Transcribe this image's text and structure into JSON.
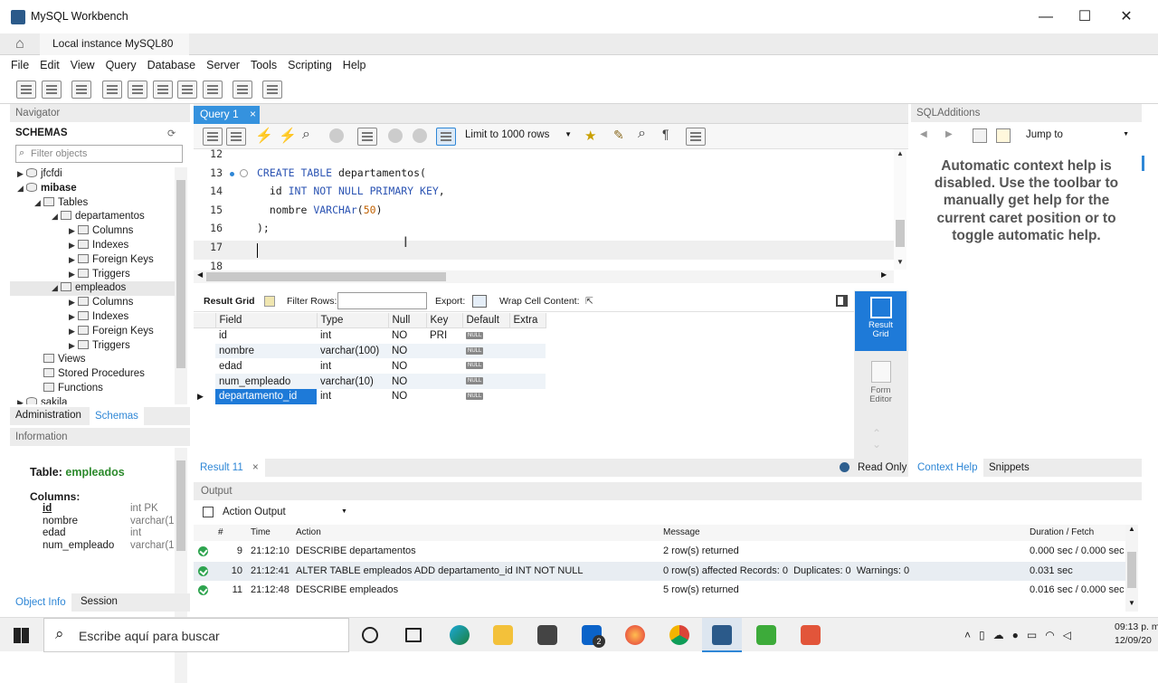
{
  "window": {
    "title": "MySQL Workbench",
    "minimize": "—",
    "maximize": "☐",
    "close": "✕"
  },
  "conn_tab": {
    "label": "Local instance MySQL80",
    "close": "×"
  },
  "menu": [
    "File",
    "Edit",
    "View",
    "Query",
    "Database",
    "Server",
    "Tools",
    "Scripting",
    "Help"
  ],
  "navigator": {
    "header": "Navigator",
    "schemas_label": "SCHEMAS",
    "filter_placeholder": "Filter objects",
    "tree": [
      {
        "label": "jfcfdi",
        "level": 0,
        "arrow": "▶",
        "bold": false
      },
      {
        "label": "mibase",
        "level": 0,
        "arrow": "◢",
        "bold": true
      },
      {
        "label": "Tables",
        "level": 1,
        "arrow": "◢",
        "bold": false
      },
      {
        "label": "departamentos",
        "level": 2,
        "arrow": "◢",
        "bold": false
      },
      {
        "label": "Columns",
        "level": 3,
        "arrow": "▶",
        "bold": false
      },
      {
        "label": "Indexes",
        "level": 3,
        "arrow": "▶",
        "bold": false
      },
      {
        "label": "Foreign Keys",
        "level": 3,
        "arrow": "▶",
        "bold": false
      },
      {
        "label": "Triggers",
        "level": 3,
        "arrow": "▶",
        "bold": false
      },
      {
        "label": "empleados",
        "level": 2,
        "arrow": "◢",
        "bold": false
      },
      {
        "label": "Columns",
        "level": 3,
        "arrow": "▶",
        "bold": false
      },
      {
        "label": "Indexes",
        "level": 3,
        "arrow": "▶",
        "bold": false
      },
      {
        "label": "Foreign Keys",
        "level": 3,
        "arrow": "▶",
        "bold": false
      },
      {
        "label": "Triggers",
        "level": 3,
        "arrow": "▶",
        "bold": false
      },
      {
        "label": "Views",
        "level": 1,
        "arrow": "",
        "bold": false
      },
      {
        "label": "Stored Procedures",
        "level": 1,
        "arrow": "",
        "bold": false
      },
      {
        "label": "Functions",
        "level": 1,
        "arrow": "",
        "bold": false
      },
      {
        "label": "sakila",
        "level": 0,
        "arrow": "▶",
        "bold": false
      }
    ],
    "tabs": [
      "Administration",
      "Schemas"
    ]
  },
  "information": {
    "header": "Information",
    "table_label": "Table:",
    "table_name": "empleados",
    "columns_label": "Columns:",
    "columns": [
      [
        "id",
        "int PK"
      ],
      [
        "nombre",
        "varchar(1"
      ],
      [
        "edad",
        "int"
      ],
      [
        "num_empleado",
        "varchar(1"
      ]
    ],
    "tabs": [
      "Object Info",
      "Session"
    ]
  },
  "query_tab": {
    "label": "Query 1",
    "close": "×"
  },
  "sql_toolbar": {
    "limit": "Limit to 1000 rows"
  },
  "editor": {
    "lines": [
      {
        "n": "12",
        "html": ""
      },
      {
        "n": "13",
        "html": "<span class='kw'>CREATE TABLE</span> departamentos("
      },
      {
        "n": "14",
        "html": "  id <span class='kw'>INT NOT NULL PRIMARY KEY</span>,"
      },
      {
        "n": "15",
        "html": "  nombre <span class='kw'>VARCHAr</span>(<span class='num'>50</span>)"
      },
      {
        "n": "16",
        "html": ");"
      },
      {
        "n": "17",
        "html": ""
      },
      {
        "n": "18",
        "html": ""
      }
    ]
  },
  "result_toolbar": {
    "result_grid": "Result Grid",
    "filter_rows": "Filter Rows:",
    "export": "Export:",
    "wrap": "Wrap Cell Content:"
  },
  "grid": {
    "headers": [
      "Field",
      "Type",
      "Null",
      "Key",
      "Default",
      "Extra"
    ],
    "rows": [
      [
        "id",
        "int",
        "NO",
        "PRI",
        "NULL",
        ""
      ],
      [
        "nombre",
        "varchar(100)",
        "NO",
        "",
        "NULL",
        ""
      ],
      [
        "edad",
        "int",
        "NO",
        "",
        "NULL",
        ""
      ],
      [
        "num_empleado",
        "varchar(10)",
        "NO",
        "",
        "NULL",
        ""
      ],
      [
        "departamento_id",
        "int",
        "NO",
        "",
        "NULL",
        ""
      ]
    ]
  },
  "side_buttons": {
    "result_grid": "Result\nGrid",
    "form_editor": "Form\nEditor"
  },
  "result_tab": {
    "label": "Result 11",
    "close": "×",
    "read_only": "Read Only"
  },
  "output": {
    "header": "Output",
    "mode": "Action Output",
    "headers": [
      "#",
      "Time",
      "Action",
      "Message",
      "Duration / Fetch"
    ],
    "rows": [
      [
        "9",
        "21:12:10",
        "DESCRIBE departamentos",
        "2 row(s) returned",
        "0.000 sec / 0.000 sec"
      ],
      [
        "10",
        "21:12:41",
        "ALTER TABLE empleados ADD departamento_id INT NOT NULL",
        "0 row(s) affected Records: 0  Duplicates: 0  Warnings: 0",
        "0.031 sec"
      ],
      [
        "11",
        "21:12:48",
        "DESCRIBE empleados",
        "5 row(s) returned",
        "0.016 sec / 0.000 sec"
      ]
    ]
  },
  "sql_additions": {
    "header": "SQLAdditions",
    "jump_to": "Jump to",
    "help_text": "Automatic context help is disabled. Use the toolbar to manually get help for the current caret position or to toggle automatic help.",
    "tabs": [
      "Context Help",
      "Snippets"
    ]
  },
  "taskbar": {
    "search_placeholder": "Escribe aquí para buscar",
    "time": "09:13 p. m.",
    "date": "12/09/20",
    "mail_badge": "2"
  },
  "colors": {
    "accent": "#2f87d6",
    "selected": "#1e7ad8",
    "tabblue": "#3592de"
  }
}
